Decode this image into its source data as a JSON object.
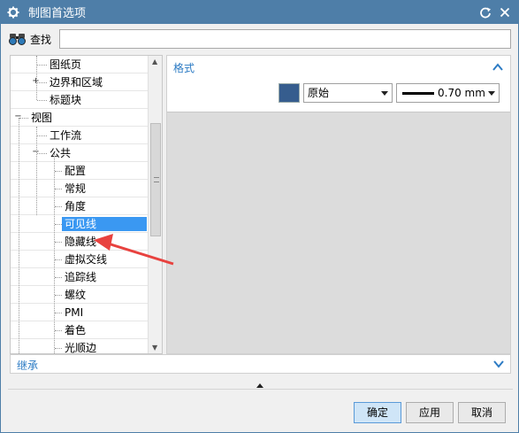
{
  "window": {
    "title": "制图首选项",
    "accent_color": "#4e7ea8",
    "controls": [
      "reset-icon",
      "close-icon"
    ]
  },
  "search": {
    "label": "查找",
    "value": "",
    "placeholder": ""
  },
  "tree": {
    "items": [
      {
        "label": "图纸页",
        "level": 1,
        "expander": ""
      },
      {
        "label": "边界和区域",
        "level": 1,
        "expander": "+"
      },
      {
        "label": "标题块",
        "level": 1,
        "expander": ""
      },
      {
        "label": "视图",
        "level": 0,
        "expander": "−"
      },
      {
        "label": "工作流",
        "level": 1,
        "expander": ""
      },
      {
        "label": "公共",
        "level": 1,
        "expander": "−"
      },
      {
        "label": "配置",
        "level": 2,
        "expander": ""
      },
      {
        "label": "常规",
        "level": 2,
        "expander": ""
      },
      {
        "label": "角度",
        "level": 2,
        "expander": ""
      },
      {
        "label": "可见线",
        "level": 2,
        "expander": "",
        "selected": true
      },
      {
        "label": "隐藏线",
        "level": 2,
        "expander": ""
      },
      {
        "label": "虚拟交线",
        "level": 2,
        "expander": ""
      },
      {
        "label": "追踪线",
        "level": 2,
        "expander": ""
      },
      {
        "label": "螺纹",
        "level": 2,
        "expander": ""
      },
      {
        "label": "PMI",
        "level": 2,
        "expander": ""
      },
      {
        "label": "着色",
        "level": 2,
        "expander": ""
      },
      {
        "label": "光顺边",
        "level": 2,
        "expander": ""
      }
    ],
    "selected_color": "#3a98f2"
  },
  "format_section": {
    "title": "格式",
    "color_swatch": "#365d8e",
    "font_select": "原始",
    "width_select": "0.70 mm"
  },
  "inherit_section": {
    "title": "继承"
  },
  "buttons": {
    "ok": "确定",
    "apply": "应用",
    "cancel": "取消"
  },
  "annotation": {
    "color": "#e8423f"
  }
}
